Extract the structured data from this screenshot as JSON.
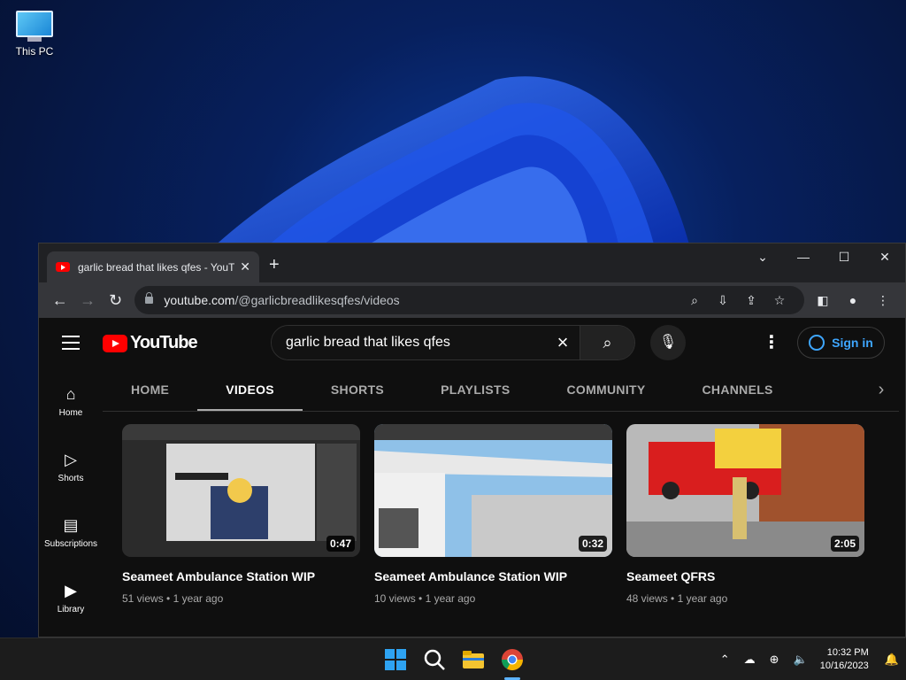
{
  "desktop": {
    "icon_label": "This PC"
  },
  "browser": {
    "tab_title": "garlic bread that likes qfes - YouTube",
    "url_domain": "youtube.com",
    "url_path": "/@garlicbreadlikesqfes/videos"
  },
  "youtube": {
    "logo_text": "YouTube",
    "search_value": "garlic bread that likes qfes",
    "signin_label": "Sign in",
    "guide": [
      {
        "label": "Home",
        "icon": "home-icon"
      },
      {
        "label": "Shorts",
        "icon": "shorts-icon"
      },
      {
        "label": "Subscriptions",
        "icon": "subscriptions-icon"
      },
      {
        "label": "Library",
        "icon": "library-icon"
      }
    ],
    "tabs": [
      "HOME",
      "VIDEOS",
      "SHORTS",
      "PLAYLISTS",
      "COMMUNITY",
      "CHANNELS"
    ],
    "active_tab": "VIDEOS",
    "videos": [
      {
        "title": "Seameet Ambulance Station WIP",
        "duration": "0:47",
        "views": "51 views",
        "age": "1 year ago"
      },
      {
        "title": "Seameet Ambulance Station WIP",
        "duration": "0:32",
        "views": "10 views",
        "age": "1 year ago"
      },
      {
        "title": "Seameet QFRS",
        "duration": "2:05",
        "views": "48 views",
        "age": "1 year ago"
      }
    ]
  },
  "taskbar": {
    "time": "10:32 PM",
    "date": "10/16/2023"
  },
  "colors": {
    "accent_red": "#ff0000",
    "link_blue": "#3ea6ff"
  }
}
